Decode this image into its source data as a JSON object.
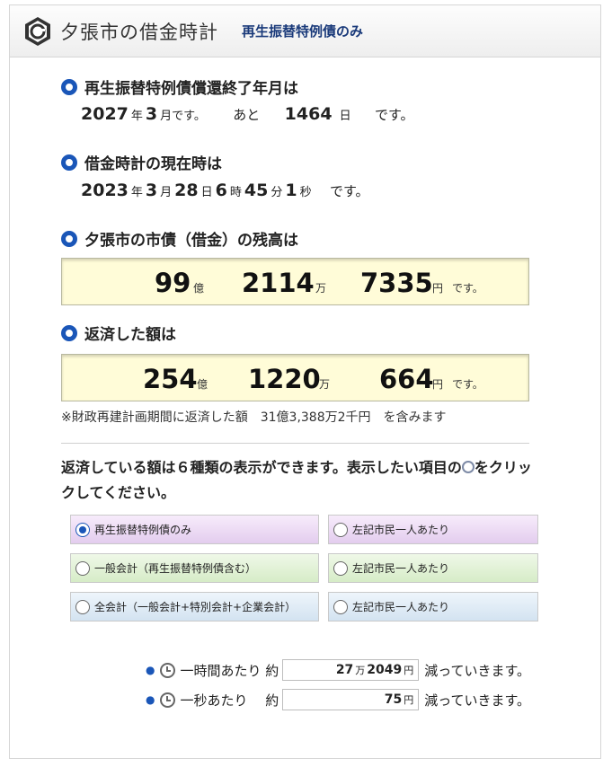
{
  "header": {
    "title": "夕張市の借金時計",
    "mode": "再生振替特例債のみ",
    "logo_icon": "yubari-emblem"
  },
  "end_section": {
    "heading": "再生振替特例債償還終了年月は",
    "year": "2027",
    "year_unit": "年",
    "month": "3",
    "month_unit": "月です。",
    "remaining_prefix": "あと",
    "days": "1464",
    "days_unit": "日",
    "suffix": "です。"
  },
  "now_section": {
    "heading": "借金時計の現在時は",
    "year": "2023",
    "year_unit": "年",
    "month": "3",
    "month_unit": "月",
    "day": "28",
    "day_unit": "日",
    "hour": "6",
    "hour_unit": "時",
    "minute": "45",
    "minute_unit": "分",
    "second": "1",
    "second_unit": "秒",
    "suffix": "です。"
  },
  "balance_section": {
    "heading": "夕張市の市債（借金）の残高は",
    "oku": "99",
    "oku_unit": "億",
    "man": "2114",
    "man_unit": "万",
    "yen": "7335",
    "yen_unit": "円",
    "suffix": "です。"
  },
  "repaid_section": {
    "heading": "返済した額は",
    "oku": "254",
    "oku_unit": "億",
    "man": "1220",
    "man_unit": "万",
    "yen": "664",
    "yen_unit": "円",
    "suffix": "です。"
  },
  "note": "※財政再建計画期間に返済した額　31億3,388万2千円　を含みます",
  "choose": {
    "text_before": "返済している額は６種類の表示ができます。表示したい項目の",
    "text_after": "をクリックしてください。"
  },
  "options": [
    {
      "label": "再生振替特例債のみ",
      "checked": true
    },
    {
      "label": "左記市民一人あたり",
      "checked": false
    },
    {
      "label": "一般会計（再生振替特例債含む）",
      "checked": false
    },
    {
      "label": "左記市民一人あたり",
      "checked": false
    },
    {
      "label": "全会計（一般会計+特別会計+企業会計）",
      "checked": false
    },
    {
      "label": "左記市民一人あたり",
      "checked": false
    }
  ],
  "rates": {
    "per_hour": {
      "label": "一時間あたり 約",
      "man": "27",
      "man_unit": "万",
      "yen": "2049",
      "yen_unit": "円",
      "suffix": "減っていきます。"
    },
    "per_second": {
      "label": "一秒あたり　 約",
      "yen": "75",
      "yen_unit": "円",
      "suffix": "減っていきます。"
    }
  }
}
